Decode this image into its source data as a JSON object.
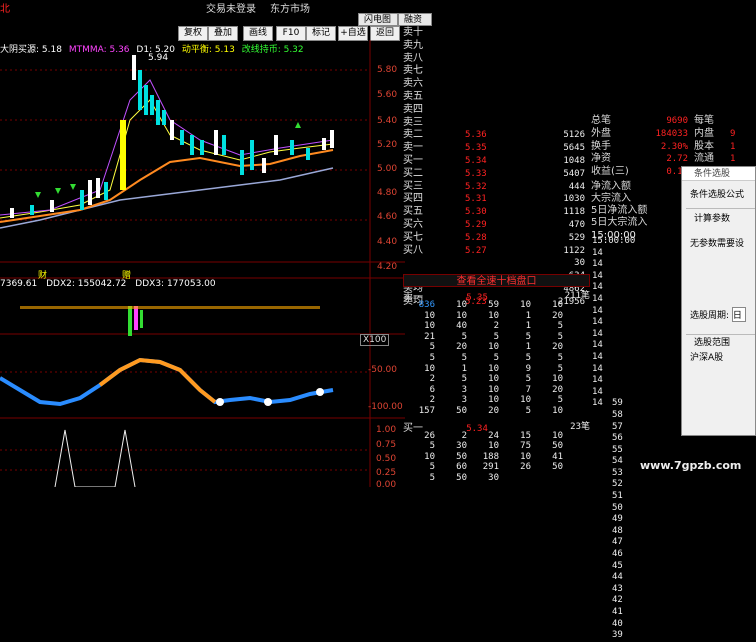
{
  "window": {
    "left_tag": "北",
    "title_status": "交易未登录",
    "title_market": "东方市场"
  },
  "tabs": [
    "闪电图",
    "融资沪"
  ],
  "toolbar": [
    "复权",
    "叠加",
    "画线",
    "F10",
    "标记",
    "+自选",
    "返回"
  ],
  "indicators": {
    "row1": [
      {
        "text": "大阴买源: 5.18",
        "color": "#ffffff"
      },
      {
        "text": "MTMMA: 5.36",
        "color": "#ff4fff"
      },
      {
        "text": "D1: 5.20",
        "color": "#ffffff"
      },
      {
        "text": "动平衡: 5.13",
        "color": "#ffff00"
      },
      {
        "text": "改线持币: 5.32",
        "color": "#33ff33"
      }
    ],
    "ma_label": "5.94",
    "row_ddx": [
      {
        "text": "7369.61",
        "color": "#ffffff"
      },
      {
        "text": "DDX2: 155042.72",
        "color": "#ffffff"
      },
      {
        "text": "DDX3: 177053.00",
        "color": "#ffffff"
      }
    ],
    "x100": "X100",
    "mark_cai": "财",
    "mark_zeng": "赠"
  },
  "price_axis": [
    "5.80",
    "5.60",
    "5.40",
    "5.20",
    "5.00",
    "4.80",
    "4.60",
    "4.40",
    "4.20"
  ],
  "lower_axis": [
    "-50.00",
    "-100.00",
    "1.00",
    "0.75",
    "0.50",
    "0.25",
    "0.00"
  ],
  "orderbook": {
    "sells": [
      {
        "label": "卖十",
        "price": "",
        "vol": ""
      },
      {
        "label": "卖九",
        "price": "",
        "vol": ""
      },
      {
        "label": "卖八",
        "price": "",
        "vol": ""
      },
      {
        "label": "卖七",
        "price": "",
        "vol": ""
      },
      {
        "label": "卖六",
        "price": "",
        "vol": ""
      },
      {
        "label": "卖五",
        "price": "",
        "vol": ""
      },
      {
        "label": "卖四",
        "price": "",
        "vol": ""
      },
      {
        "label": "卖三",
        "price": "",
        "vol": ""
      },
      {
        "label": "卖二",
        "price": "5.36",
        "vol": "5126"
      },
      {
        "label": "卖一",
        "price": "5.35",
        "vol": "5645"
      }
    ],
    "buys": [
      {
        "label": "买一",
        "price": "5.34",
        "vol": "1048"
      },
      {
        "label": "买二",
        "price": "5.33",
        "vol": "5407"
      },
      {
        "label": "买三",
        "price": "5.32",
        "vol": "444"
      },
      {
        "label": "买四",
        "price": "5.31",
        "vol": "1030"
      },
      {
        "label": "买五",
        "price": "5.30",
        "vol": "1118"
      },
      {
        "label": "买六",
        "price": "5.29",
        "vol": "470"
      },
      {
        "label": "买七",
        "price": "5.28",
        "vol": "529"
      },
      {
        "label": "买八",
        "price": "5.27",
        "vol": "1122"
      }
    ],
    "tail": [
      {
        "label": "",
        "price": "",
        "vol": "30"
      },
      {
        "label": "",
        "price": "",
        "vol": "634"
      },
      {
        "label": "买均",
        "price": "",
        "vol": "4862"
      },
      {
        "label": "卖均",
        "price": "5.23",
        "vol": "21956"
      }
    ],
    "total_buy_label": "总买",
    "total_sell_label": "总买",
    "link": "查看全速十档盘口"
  },
  "stats": [
    {
      "label": "总笔",
      "value": "9690",
      "label2": "每笔",
      "value2": ""
    },
    {
      "label": "外盘",
      "value": "184033",
      "label2": "内盘",
      "value2": "9"
    },
    {
      "label": "换手",
      "value": "2.30%",
      "label2": "股本",
      "value2": "1"
    },
    {
      "label": "净资",
      "value": "2.72",
      "label2": "流通",
      "value2": "1"
    },
    {
      "label": "收益(三)",
      "value": "0.12",
      "label2": "",
      "value2": ""
    }
  ],
  "flows": [
    "净流入额",
    "大宗流入",
    "5日净流入额",
    "5日大宗流入"
  ],
  "time_label": "15:00:00",
  "queue_sell": {
    "label": "卖一",
    "price": "5.35",
    "count": "211笔"
  },
  "queue_sell_rows": [
    [
      "836",
      "10",
      "59",
      "10",
      "10"
    ],
    [
      "10",
      "10",
      "10",
      "1",
      "20"
    ],
    [
      "10",
      "40",
      "2",
      "1",
      "5"
    ],
    [
      "21",
      "5",
      "5",
      "5",
      "5"
    ],
    [
      "5",
      "20",
      "10",
      "1",
      "20"
    ],
    [
      "5",
      "5",
      "5",
      "5",
      "5"
    ],
    [
      "10",
      "1",
      "10",
      "9",
      "5"
    ],
    [
      "2",
      "5",
      "10",
      "5",
      "10"
    ],
    [
      "6",
      "3",
      "10",
      "7",
      "20"
    ],
    [
      "2",
      "3",
      "10",
      "10",
      "5"
    ],
    [
      "157",
      "50",
      "20",
      "5",
      "10"
    ]
  ],
  "queue_buy": {
    "label": "买一",
    "price": "5.34",
    "count": "23笔"
  },
  "queue_buy_rows": [
    [
      "26",
      "2",
      "24",
      "15",
      "10"
    ],
    [
      "5",
      "30",
      "10",
      "75",
      "50"
    ],
    [
      "10",
      "50",
      "188",
      "10",
      "41"
    ],
    [
      "5",
      "60",
      "291",
      "26",
      "50"
    ],
    [
      "5",
      "50",
      "30",
      "",
      ""
    ]
  ],
  "time_list": [
    "15:00:00",
    "14",
    "14",
    "14",
    "14",
    "14",
    "14",
    "14",
    "14",
    "14",
    "14",
    "14",
    "14",
    "14",
    "14"
  ],
  "minute_list": [
    "",
    "",
    "",
    "",
    "",
    "",
    "",
    "",
    "",
    "",
    "",
    "",
    "",
    "",
    "59",
    "58",
    "57",
    "56",
    "55",
    "54",
    "53",
    "52",
    "51",
    "50",
    "49",
    "48",
    "47",
    "46",
    "45",
    "44",
    "43",
    "42",
    "41",
    "40",
    "39"
  ],
  "dialog": {
    "title": "条件选股",
    "tab": "条件选股公式",
    "section": "计算参数",
    "no_param": "无参数需要设",
    "period_label": "选股周期:",
    "period_value": "日",
    "range_label": "选股范围",
    "range_value": "沪深A股"
  },
  "watermark": "www.7gpzb.com",
  "colors": {
    "up": "#ff3030",
    "down": "#00e0e0",
    "grid": "#770000",
    "accent_yellow": "#ffff00"
  }
}
